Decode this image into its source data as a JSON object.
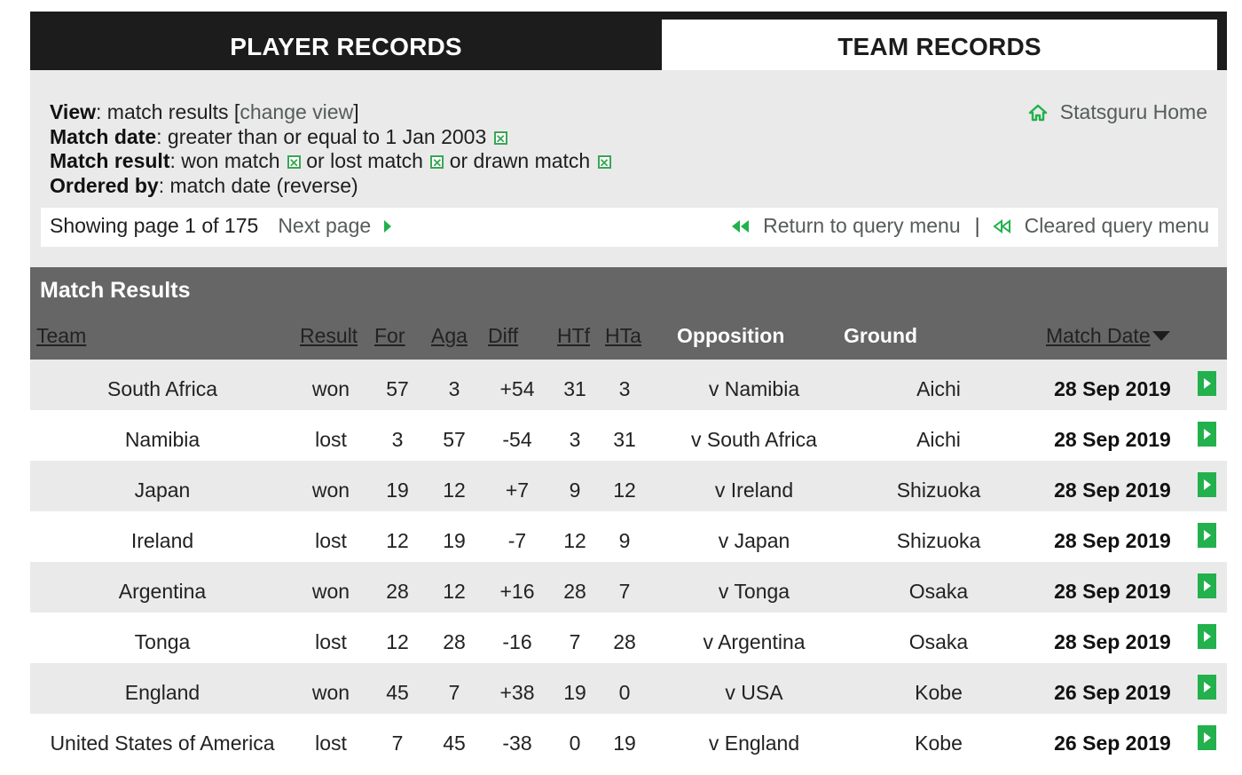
{
  "tabs": {
    "player_records": "PLAYER RECORDS",
    "team_records": "TEAM RECORDS"
  },
  "filters": {
    "view_label": "View",
    "view_value": ": match results [",
    "view_change_link": "change view",
    "view_close": "]",
    "match_date_label": "Match date",
    "match_date_value": ": greater than or equal to 1 Jan 2003",
    "match_result_label": "Match result",
    "match_result_won": ": won match",
    "match_result_lost": "or lost match",
    "match_result_drawn": "or drawn match",
    "ordered_by_label": "Ordered by",
    "ordered_by_value": ": match date (reverse)",
    "remove_icon_glyph": "✕"
  },
  "home_link": "Statsguru Home",
  "pager": {
    "status": "Showing page 1 of 175",
    "next_page": "Next page",
    "return_query": "Return to query menu",
    "separator": "|",
    "cleared_query": "Cleared query menu"
  },
  "results": {
    "title": "Match Results",
    "columns": {
      "team": "Team",
      "result": "Result",
      "for": "For",
      "aga": "Aga",
      "diff": "Diff",
      "htf": "HTf",
      "hta": "HTa",
      "opposition": "Opposition",
      "ground": "Ground",
      "match_date": "Match Date"
    },
    "rows": [
      {
        "team": "South Africa",
        "result": "won",
        "for": "57",
        "aga": "3",
        "diff": "+54",
        "htf": "31",
        "hta": "3",
        "opposition": "v Namibia",
        "ground": "Aichi",
        "date": "28 Sep 2019"
      },
      {
        "team": "Namibia",
        "result": "lost",
        "for": "3",
        "aga": "57",
        "diff": "-54",
        "htf": "3",
        "hta": "31",
        "opposition": "v South Africa",
        "ground": "Aichi",
        "date": "28 Sep 2019"
      },
      {
        "team": "Japan",
        "result": "won",
        "for": "19",
        "aga": "12",
        "diff": "+7",
        "htf": "9",
        "hta": "12",
        "opposition": "v Ireland",
        "ground": "Shizuoka",
        "date": "28 Sep 2019"
      },
      {
        "team": "Ireland",
        "result": "lost",
        "for": "12",
        "aga": "19",
        "diff": "-7",
        "htf": "12",
        "hta": "9",
        "opposition": "v Japan",
        "ground": "Shizuoka",
        "date": "28 Sep 2019"
      },
      {
        "team": "Argentina",
        "result": "won",
        "for": "28",
        "aga": "12",
        "diff": "+16",
        "htf": "28",
        "hta": "7",
        "opposition": "v Tonga",
        "ground": "Osaka",
        "date": "28 Sep 2019"
      },
      {
        "team": "Tonga",
        "result": "lost",
        "for": "12",
        "aga": "28",
        "diff": "-16",
        "htf": "7",
        "hta": "28",
        "opposition": "v Argentina",
        "ground": "Osaka",
        "date": "28 Sep 2019"
      },
      {
        "team": "England",
        "result": "won",
        "for": "45",
        "aga": "7",
        "diff": "+38",
        "htf": "19",
        "hta": "0",
        "opposition": "v USA",
        "ground": "Kobe",
        "date": "26 Sep 2019"
      },
      {
        "team": "United States of America",
        "result": "lost",
        "for": "7",
        "aga": "45",
        "diff": "-38",
        "htf": "0",
        "hta": "19",
        "opposition": "v England",
        "ground": "Kobe",
        "date": "26 Sep 2019"
      }
    ]
  },
  "colors": {
    "accent_green": "#22b14c",
    "header_dark": "#1c1c1c",
    "table_header_gray": "#666666",
    "panel_gray": "#eaeaea"
  },
  "icons": {
    "home": "home-icon",
    "next": "play-right-icon",
    "return": "rewind-icon",
    "cleared": "rewind-outline-icon",
    "remove_filter": "close-box-icon",
    "row_detail": "play-button-icon"
  }
}
